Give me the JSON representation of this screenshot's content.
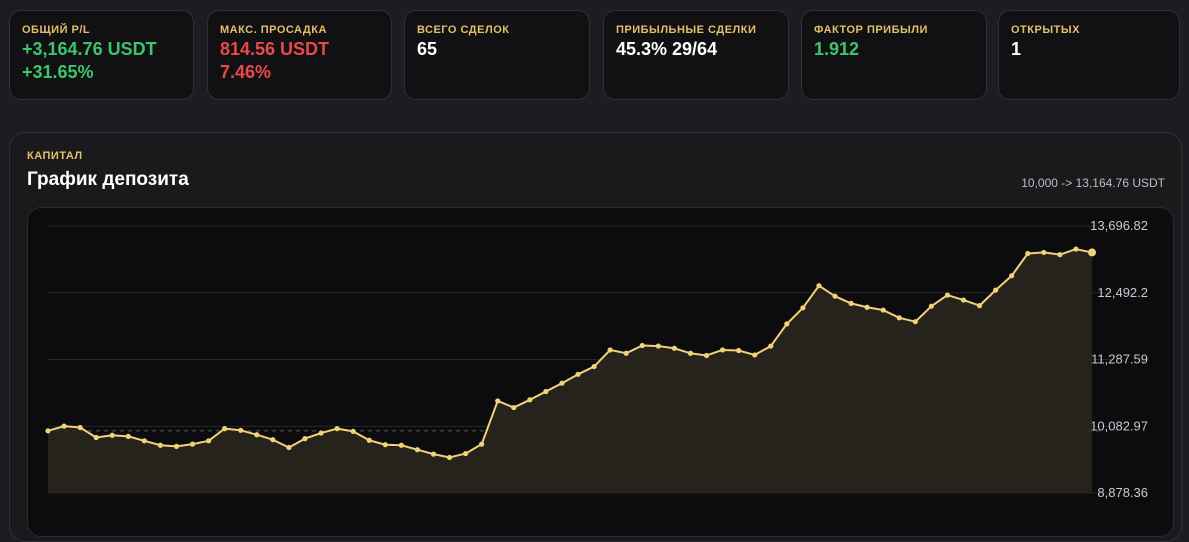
{
  "stats": [
    {
      "label": "ОБЩИЙ P/L",
      "lines": [
        "+3,164.76 USDT",
        "+31.65%"
      ],
      "color": "#3ec46d"
    },
    {
      "label": "МАКС. ПРОСАДКА",
      "lines": [
        "814.56 USDT",
        "7.46%"
      ],
      "color": "#e84a4a"
    },
    {
      "label": "ВСЕГО СДЕЛОК",
      "lines": [
        "65"
      ],
      "color": "#ffffff"
    },
    {
      "label": "ПРИБЫЛЬНЫЕ СДЕЛКИ",
      "lines": [
        "45.3% 29/64"
      ],
      "color": "#ffffff"
    },
    {
      "label": "ФАКТОР ПРИБЫЛИ",
      "lines": [
        "1.912"
      ],
      "color": "#3ec46d"
    },
    {
      "label": "ОТКРЫТЫХ",
      "lines": [
        "1"
      ],
      "color": "#ffffff"
    }
  ],
  "panel": {
    "eyebrow": "КАПИТАЛ",
    "title": "График депозита",
    "range": "10,000 -> 13,164.76 USDT"
  },
  "colors": {
    "accent": "#e2c06a",
    "line": "#f0d27a",
    "positive": "#3ec46d",
    "negative": "#e84a4a",
    "area_fill": "#2b2820"
  },
  "chart_data": {
    "type": "line",
    "title": "График депозита",
    "ylim": [
      8878.36,
      13696.82
    ],
    "yticks": [
      "13,696.82",
      "12,492.2",
      "11,287.59",
      "10,082.97",
      "8,878.36"
    ],
    "ytick_values": [
      13696.82,
      12492.2,
      11287.59,
      10082.97,
      8878.36
    ],
    "baseline": 10000,
    "series": [
      {
        "values": [
          10000,
          10085,
          10060,
          9880,
          9920,
          9900,
          9820,
          9740,
          9720,
          9760,
          9820,
          10040,
          10010,
          9930,
          9840,
          9700,
          9860,
          9960,
          10040,
          9990,
          9830,
          9750,
          9740,
          9660,
          9580,
          9520,
          9590,
          9760,
          10540,
          10420,
          10560,
          10710,
          10860,
          11020,
          11160,
          11460,
          11400,
          11540,
          11530,
          11490,
          11400,
          11360,
          11460,
          11450,
          11370,
          11530,
          11930,
          12220,
          12620,
          12430,
          12300,
          12230,
          12180,
          12040,
          11970,
          12250,
          12450,
          12360,
          12260,
          12540,
          12800,
          13200,
          13220,
          13180,
          13280,
          13220
        ]
      }
    ]
  }
}
